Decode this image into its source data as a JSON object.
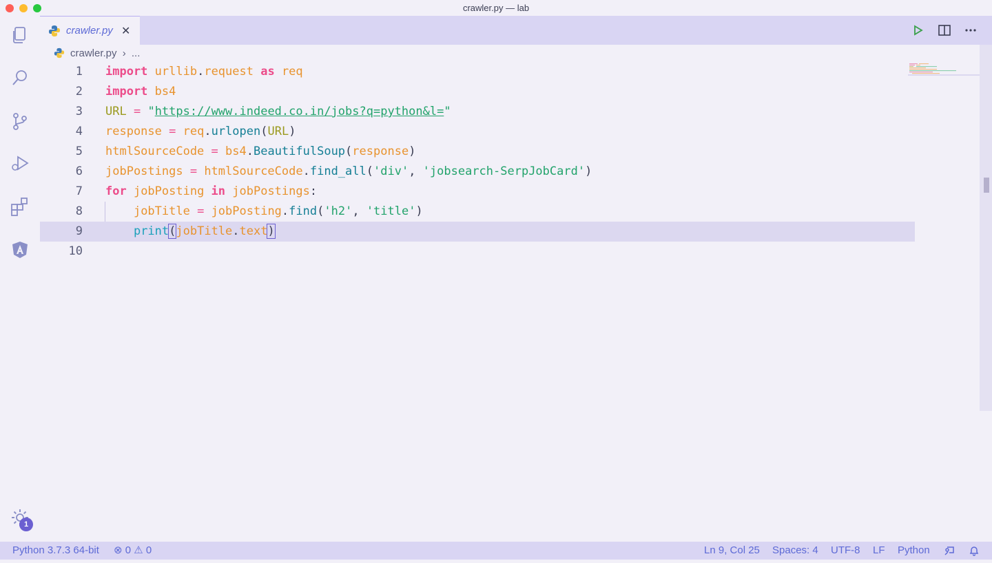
{
  "window": {
    "title": "crawler.py — lab"
  },
  "tab": {
    "label": "crawler.py",
    "close": "✕"
  },
  "breadcrumb": {
    "file": "crawler.py",
    "sep": "›",
    "more": "..."
  },
  "editor": {
    "line_numbers": [
      "1",
      "2",
      "3",
      "4",
      "5",
      "6",
      "7",
      "8",
      "9",
      "10"
    ],
    "lines": [
      [
        {
          "t": "import",
          "c": "kw"
        },
        {
          "t": " urllib",
          "c": "var"
        },
        {
          "t": ".",
          "c": "punc"
        },
        {
          "t": "request",
          "c": "var"
        },
        {
          "t": " as",
          "c": "kw"
        },
        {
          "t": " req",
          "c": "var"
        }
      ],
      [
        {
          "t": "import",
          "c": "kw"
        },
        {
          "t": " bs4",
          "c": "var"
        }
      ],
      [
        {
          "t": "URL",
          "c": "const"
        },
        {
          "t": " = ",
          "c": "op"
        },
        {
          "t": "\"",
          "c": "str"
        },
        {
          "t": "https://www.indeed.co.in/jobs?q=python&l=",
          "c": "url"
        },
        {
          "t": "\"",
          "c": "str"
        }
      ],
      [
        {
          "t": "response",
          "c": "var"
        },
        {
          "t": " = ",
          "c": "op"
        },
        {
          "t": "req",
          "c": "var"
        },
        {
          "t": ".",
          "c": "punc"
        },
        {
          "t": "urlopen",
          "c": "fn"
        },
        {
          "t": "(",
          "c": "punc"
        },
        {
          "t": "URL",
          "c": "const"
        },
        {
          "t": ")",
          "c": "punc"
        }
      ],
      [
        {
          "t": "htmlSourceCode",
          "c": "var"
        },
        {
          "t": " = ",
          "c": "op"
        },
        {
          "t": "bs4",
          "c": "var"
        },
        {
          "t": ".",
          "c": "punc"
        },
        {
          "t": "BeautifulSoup",
          "c": "cls"
        },
        {
          "t": "(",
          "c": "punc"
        },
        {
          "t": "response",
          "c": "var"
        },
        {
          "t": ")",
          "c": "punc"
        }
      ],
      [
        {
          "t": "jobPostings",
          "c": "var"
        },
        {
          "t": " = ",
          "c": "op"
        },
        {
          "t": "htmlSourceCode",
          "c": "var"
        },
        {
          "t": ".",
          "c": "punc"
        },
        {
          "t": "find_all",
          "c": "fn"
        },
        {
          "t": "(",
          "c": "punc"
        },
        {
          "t": "'div'",
          "c": "str"
        },
        {
          "t": ", ",
          "c": "punc"
        },
        {
          "t": "'jobsearch-SerpJobCard'",
          "c": "str"
        },
        {
          "t": ")",
          "c": "punc"
        }
      ],
      [
        {
          "t": "for",
          "c": "kw"
        },
        {
          "t": " jobPosting",
          "c": "var"
        },
        {
          "t": " in",
          "c": "kw"
        },
        {
          "t": " jobPostings",
          "c": "var"
        },
        {
          "t": ":",
          "c": "punc"
        }
      ],
      [
        {
          "t": "    ",
          "c": "punc"
        },
        {
          "t": "jobTitle",
          "c": "var"
        },
        {
          "t": " = ",
          "c": "op"
        },
        {
          "t": "jobPosting",
          "c": "var"
        },
        {
          "t": ".",
          "c": "punc"
        },
        {
          "t": "find",
          "c": "fn"
        },
        {
          "t": "(",
          "c": "punc"
        },
        {
          "t": "'h2'",
          "c": "str"
        },
        {
          "t": ", ",
          "c": "punc"
        },
        {
          "t": "'title'",
          "c": "str"
        },
        {
          "t": ")",
          "c": "punc"
        }
      ],
      [
        {
          "t": "    ",
          "c": "punc"
        },
        {
          "t": "print",
          "c": "call"
        },
        {
          "t": "(",
          "c": "punc bracket"
        },
        {
          "t": "jobTitle",
          "c": "var"
        },
        {
          "t": ".",
          "c": "punc"
        },
        {
          "t": "text",
          "c": "var"
        },
        {
          "t": ")",
          "c": "punc bracket"
        }
      ],
      []
    ],
    "active_line": 9
  },
  "status": {
    "interpreter": "Python 3.7.3 64-bit",
    "errors": "0",
    "warnings": "0",
    "position": "Ln 9, Col 25",
    "spaces": "Spaces: 4",
    "encoding": "UTF-8",
    "eol": "LF",
    "language": "Python"
  },
  "activity": {
    "badge": "1"
  },
  "colors": {
    "accent": "#5d6ad6",
    "keyword": "#ec4c8a",
    "variable": "#e8932e",
    "string": "#22a36b"
  }
}
